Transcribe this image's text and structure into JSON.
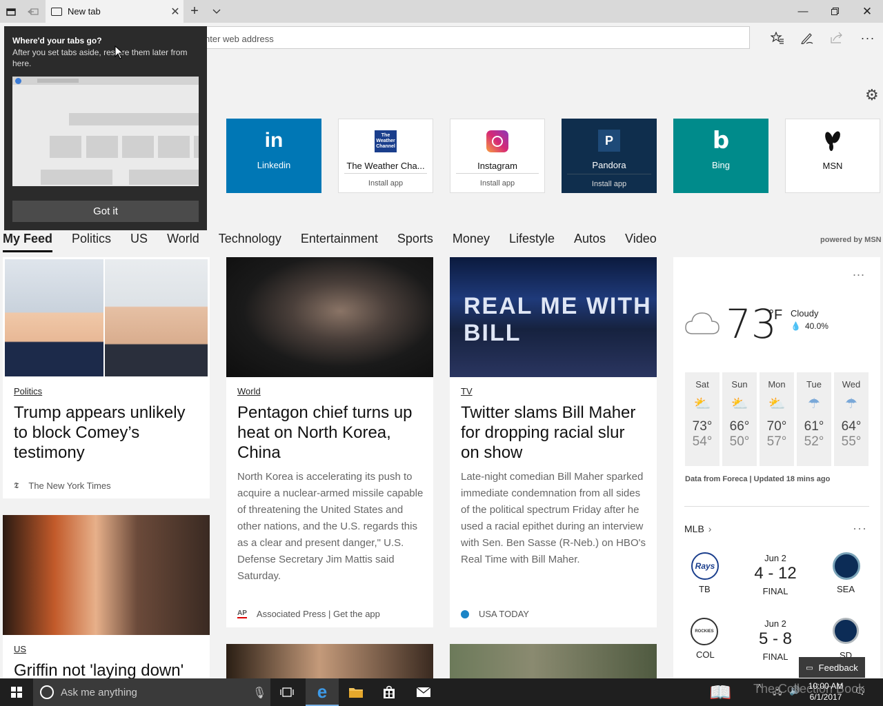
{
  "browser": {
    "tab_title": "New tab",
    "address_placeholder": "nter web address",
    "icons": [
      "tab-preview-icon",
      "set-aside-icon",
      "new-tab-icon",
      "tab-list-icon",
      "favorites-icon",
      "notes-icon",
      "share-icon",
      "more-icon",
      "minimize-icon",
      "restore-icon",
      "close-icon"
    ]
  },
  "popup": {
    "heading": "Where'd your tabs go?",
    "body": "After you set tabs aside, restore them later from here.",
    "button": "Got it"
  },
  "top_sites": [
    {
      "name": "Linkedin",
      "icon": "in",
      "install": "",
      "bg": "#0077b5"
    },
    {
      "name": "The Weather Cha...",
      "icon": "The Weather Channel",
      "install": "Install app",
      "bg": "#ffffff"
    },
    {
      "name": "Instagram",
      "icon": "instagram-icon",
      "install": "Install app",
      "bg": "#ffffff"
    },
    {
      "name": "Pandora",
      "icon": "P",
      "install": "Install app",
      "bg": "#0f2e4d"
    },
    {
      "name": "Bing",
      "icon": "b",
      "install": "",
      "bg": "#008b8b"
    },
    {
      "name": "MSN",
      "icon": "msn-butterfly-icon",
      "install": "",
      "bg": "#ffffff"
    }
  ],
  "nav": {
    "items": [
      "My Feed",
      "Politics",
      "US",
      "World",
      "Technology",
      "Entertainment",
      "Sports",
      "Money",
      "Lifestyle",
      "Autos",
      "Video"
    ],
    "powered": "powered by MSN"
  },
  "cards": [
    {
      "category": "Politics",
      "headline": "Trump appears unlikely to block Comey’s testimony",
      "snippet": "",
      "source": "The New York Times",
      "source_extra": ""
    },
    {
      "category": "World",
      "headline": "Pentagon chief turns up heat on North Korea, China",
      "snippet": "North Korea is accelerating its push to acquire a nuclear-armed missile capable of threatening the United States and other nations, and the U.S. regards this as a clear and present danger,\" U.S. Defense Secretary Jim Mattis said Saturday.",
      "source": "Associated Press",
      "source_extra": "| Get the app"
    },
    {
      "category": "TV",
      "headline": "Twitter slams Bill Maher for dropping racial slur on show",
      "snippet": "Late-night comedian Bill Maher sparked immediate condemnation from all sides of the political spectrum Friday after he used a racial epithet during an interview with Sen. Ben Sasse (R-Neb.) on HBO's Real Time with Bill Maher.",
      "source": "USA TODAY",
      "source_extra": ""
    },
    {
      "category": "US",
      "headline": "Griffin not 'laying down'",
      "snippet": "",
      "source": "",
      "source_extra": ""
    }
  ],
  "photo_text": {
    "set_sign": "REAL  ME WITH BILL"
  },
  "weather": {
    "temp": "73",
    "unit": "°F",
    "condition": "Cloudy",
    "precip": "40.0%",
    "forecast": [
      {
        "day": "Sat",
        "high": "73°",
        "low": "54°",
        "icon": "partly-sunny-icon"
      },
      {
        "day": "Sun",
        "high": "66°",
        "low": "50°",
        "icon": "partly-sunny-icon"
      },
      {
        "day": "Mon",
        "high": "70°",
        "low": "57°",
        "icon": "partly-sunny-icon"
      },
      {
        "day": "Tue",
        "high": "61°",
        "low": "52°",
        "icon": "rain-icon"
      },
      {
        "day": "Wed",
        "high": "64°",
        "low": "55°",
        "icon": "rain-icon"
      }
    ],
    "footer": "Data from Foreca | Updated 18 mins ago",
    "more": "..."
  },
  "mlb": {
    "title": "MLB",
    "games": [
      {
        "date": "Jun 2",
        "score": "4 - 12",
        "status": "FINAL",
        "away": "TB",
        "home": "SEA",
        "away_logo": "Rays"
      },
      {
        "date": "Jun 2",
        "score": "5 - 8",
        "status": "FINAL",
        "away": "COL",
        "home": "SD",
        "away_logo": "ROCKIES"
      }
    ]
  },
  "feedback": "Feedback",
  "taskbar": {
    "search": "Ask me anything",
    "time": "10:00 AM",
    "date": "6/1/2017",
    "watermark": "The Collection Book"
  }
}
